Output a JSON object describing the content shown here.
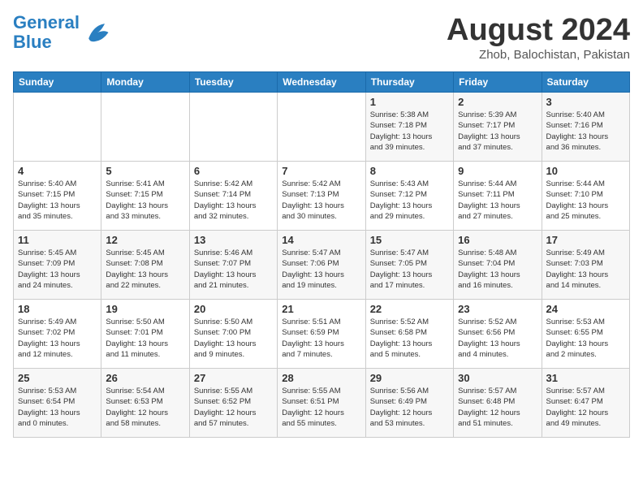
{
  "header": {
    "logo_line1": "General",
    "logo_line2": "Blue",
    "month_title": "August 2024",
    "location": "Zhob, Balochistan, Pakistan"
  },
  "days_of_week": [
    "Sunday",
    "Monday",
    "Tuesday",
    "Wednesday",
    "Thursday",
    "Friday",
    "Saturday"
  ],
  "weeks": [
    {
      "cells": [
        {
          "day": "",
          "info": ""
        },
        {
          "day": "",
          "info": ""
        },
        {
          "day": "",
          "info": ""
        },
        {
          "day": "",
          "info": ""
        },
        {
          "day": "1",
          "info": "Sunrise: 5:38 AM\nSunset: 7:18 PM\nDaylight: 13 hours\nand 39 minutes."
        },
        {
          "day": "2",
          "info": "Sunrise: 5:39 AM\nSunset: 7:17 PM\nDaylight: 13 hours\nand 37 minutes."
        },
        {
          "day": "3",
          "info": "Sunrise: 5:40 AM\nSunset: 7:16 PM\nDaylight: 13 hours\nand 36 minutes."
        }
      ]
    },
    {
      "cells": [
        {
          "day": "4",
          "info": "Sunrise: 5:40 AM\nSunset: 7:15 PM\nDaylight: 13 hours\nand 35 minutes."
        },
        {
          "day": "5",
          "info": "Sunrise: 5:41 AM\nSunset: 7:15 PM\nDaylight: 13 hours\nand 33 minutes."
        },
        {
          "day": "6",
          "info": "Sunrise: 5:42 AM\nSunset: 7:14 PM\nDaylight: 13 hours\nand 32 minutes."
        },
        {
          "day": "7",
          "info": "Sunrise: 5:42 AM\nSunset: 7:13 PM\nDaylight: 13 hours\nand 30 minutes."
        },
        {
          "day": "8",
          "info": "Sunrise: 5:43 AM\nSunset: 7:12 PM\nDaylight: 13 hours\nand 29 minutes."
        },
        {
          "day": "9",
          "info": "Sunrise: 5:44 AM\nSunset: 7:11 PM\nDaylight: 13 hours\nand 27 minutes."
        },
        {
          "day": "10",
          "info": "Sunrise: 5:44 AM\nSunset: 7:10 PM\nDaylight: 13 hours\nand 25 minutes."
        }
      ]
    },
    {
      "cells": [
        {
          "day": "11",
          "info": "Sunrise: 5:45 AM\nSunset: 7:09 PM\nDaylight: 13 hours\nand 24 minutes."
        },
        {
          "day": "12",
          "info": "Sunrise: 5:45 AM\nSunset: 7:08 PM\nDaylight: 13 hours\nand 22 minutes."
        },
        {
          "day": "13",
          "info": "Sunrise: 5:46 AM\nSunset: 7:07 PM\nDaylight: 13 hours\nand 21 minutes."
        },
        {
          "day": "14",
          "info": "Sunrise: 5:47 AM\nSunset: 7:06 PM\nDaylight: 13 hours\nand 19 minutes."
        },
        {
          "day": "15",
          "info": "Sunrise: 5:47 AM\nSunset: 7:05 PM\nDaylight: 13 hours\nand 17 minutes."
        },
        {
          "day": "16",
          "info": "Sunrise: 5:48 AM\nSunset: 7:04 PM\nDaylight: 13 hours\nand 16 minutes."
        },
        {
          "day": "17",
          "info": "Sunrise: 5:49 AM\nSunset: 7:03 PM\nDaylight: 13 hours\nand 14 minutes."
        }
      ]
    },
    {
      "cells": [
        {
          "day": "18",
          "info": "Sunrise: 5:49 AM\nSunset: 7:02 PM\nDaylight: 13 hours\nand 12 minutes."
        },
        {
          "day": "19",
          "info": "Sunrise: 5:50 AM\nSunset: 7:01 PM\nDaylight: 13 hours\nand 11 minutes."
        },
        {
          "day": "20",
          "info": "Sunrise: 5:50 AM\nSunset: 7:00 PM\nDaylight: 13 hours\nand 9 minutes."
        },
        {
          "day": "21",
          "info": "Sunrise: 5:51 AM\nSunset: 6:59 PM\nDaylight: 13 hours\nand 7 minutes."
        },
        {
          "day": "22",
          "info": "Sunrise: 5:52 AM\nSunset: 6:58 PM\nDaylight: 13 hours\nand 5 minutes."
        },
        {
          "day": "23",
          "info": "Sunrise: 5:52 AM\nSunset: 6:56 PM\nDaylight: 13 hours\nand 4 minutes."
        },
        {
          "day": "24",
          "info": "Sunrise: 5:53 AM\nSunset: 6:55 PM\nDaylight: 13 hours\nand 2 minutes."
        }
      ]
    },
    {
      "cells": [
        {
          "day": "25",
          "info": "Sunrise: 5:53 AM\nSunset: 6:54 PM\nDaylight: 13 hours\nand 0 minutes."
        },
        {
          "day": "26",
          "info": "Sunrise: 5:54 AM\nSunset: 6:53 PM\nDaylight: 12 hours\nand 58 minutes."
        },
        {
          "day": "27",
          "info": "Sunrise: 5:55 AM\nSunset: 6:52 PM\nDaylight: 12 hours\nand 57 minutes."
        },
        {
          "day": "28",
          "info": "Sunrise: 5:55 AM\nSunset: 6:51 PM\nDaylight: 12 hours\nand 55 minutes."
        },
        {
          "day": "29",
          "info": "Sunrise: 5:56 AM\nSunset: 6:49 PM\nDaylight: 12 hours\nand 53 minutes."
        },
        {
          "day": "30",
          "info": "Sunrise: 5:57 AM\nSunset: 6:48 PM\nDaylight: 12 hours\nand 51 minutes."
        },
        {
          "day": "31",
          "info": "Sunrise: 5:57 AM\nSunset: 6:47 PM\nDaylight: 12 hours\nand 49 minutes."
        }
      ]
    }
  ]
}
